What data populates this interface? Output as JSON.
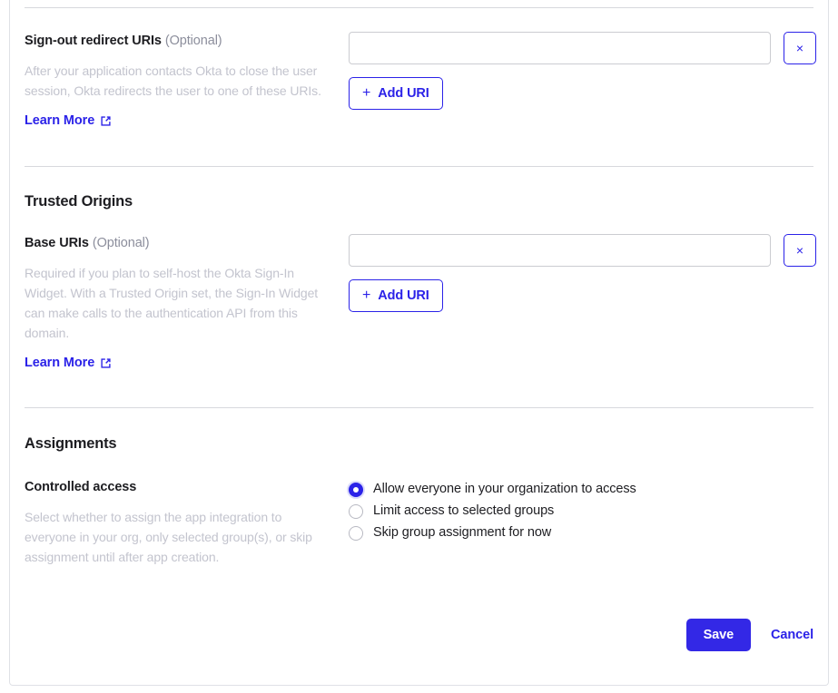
{
  "colors": {
    "accent": "#2b22e8",
    "save_button_bg": "#3328e6",
    "label_text": "#1d1d21",
    "description_text": "#c3c4ce",
    "optional_text": "#8c8e9c",
    "input_border": "#cbccd1",
    "divider": "#d7d8dd",
    "card_border": "#dfe1e6"
  },
  "signout_redirect": {
    "label": "Sign-out redirect URIs",
    "optional": "(Optional)",
    "description": "After your application contacts Okta to close the user session, Okta redirects the user to one of these URIs.",
    "learn_more": "Learn More",
    "learn_more_icon": "external-link-icon",
    "input_value": "",
    "input_placeholder": "",
    "remove_icon": "close-icon",
    "remove_label": "×",
    "add_button": "Add URI",
    "add_icon": "plus-icon"
  },
  "trusted_origins": {
    "title": "Trusted Origins",
    "label": "Base URIs",
    "optional": "(Optional)",
    "description": "Required if you plan to self-host the Okta Sign-In Widget. With a Trusted Origin set, the Sign-In Widget can make calls to the authentication API from this domain.",
    "learn_more": "Learn More",
    "learn_more_icon": "external-link-icon",
    "input_value": "",
    "input_placeholder": "",
    "remove_icon": "close-icon",
    "remove_label": "×",
    "add_button": "Add URI",
    "add_icon": "plus-icon"
  },
  "assignments": {
    "title": "Assignments",
    "label": "Controlled access",
    "description": "Select whether to assign the app integration to everyone in your org, only selected group(s), or skip assignment until after app creation.",
    "options": [
      {
        "label": "Allow everyone in your organization to access",
        "selected": true
      },
      {
        "label": "Limit access to selected groups",
        "selected": false
      },
      {
        "label": "Skip group assignment for now",
        "selected": false
      }
    ]
  },
  "footer": {
    "save_label": "Save",
    "cancel_label": "Cancel"
  }
}
